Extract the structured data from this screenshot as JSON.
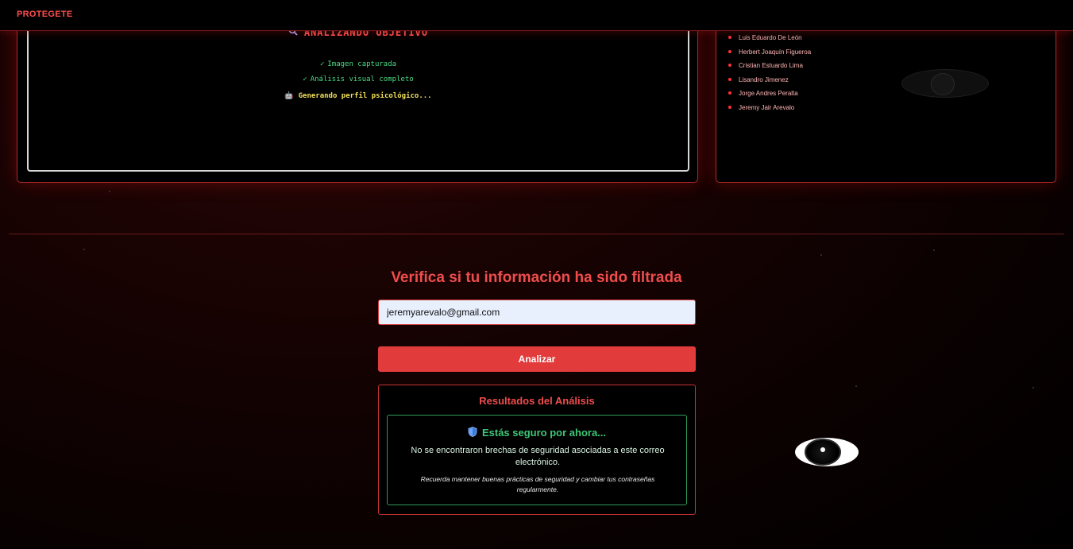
{
  "navbar": {
    "brand": "PROTEGETE"
  },
  "analysis_panel": {
    "title": "ANALIZANDO OBJETIVO",
    "title_icon": "magnifier-icon",
    "steps": [
      {
        "mark": "✓",
        "label": "Imagen capturada",
        "status": "done"
      },
      {
        "mark": "✓",
        "label": "Análisis visual completo",
        "status": "done"
      },
      {
        "mark": "🤖",
        "label": "Generando perfil psicológico...",
        "status": "active"
      }
    ]
  },
  "names_panel": {
    "names": [
      "Luis Eduardo De León",
      "Herbert Joaquín Figueroa",
      "Cristian Estuardo Lima",
      "Lisandro Jimenez",
      "Jorge Andres Peralta",
      "Jeremy Jair Arevalo"
    ]
  },
  "verify": {
    "title": "Verifica si tu información ha sido filtrada",
    "email_value": "jeremyarevalo@gmail.com",
    "analyze_label": "Analizar"
  },
  "results": {
    "title": "Resultados del Análisis",
    "status_icon": "shield-icon",
    "status_title": "Estás seguro por ahora...",
    "message": "No se encontraron brechas de seguridad asociadas a este correo electrónico.",
    "tip": "Recuerda mantener buenas prácticas de seguridad y cambiar tus contraseñas regularmente."
  },
  "colors": {
    "accent_red": "#e23b3b",
    "safe_green": "#3ec777",
    "step_done": "#4ddc84",
    "step_active": "#f2e05a"
  }
}
